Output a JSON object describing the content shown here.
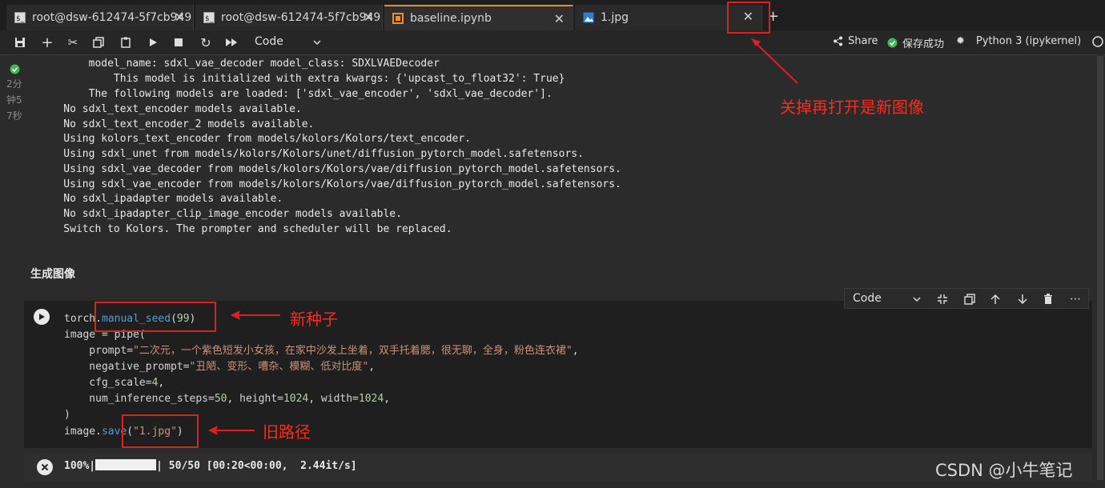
{
  "tabs": [
    {
      "label": "root@dsw-612474-5f7cb949",
      "icon": "terminal-icon"
    },
    {
      "label": "root@dsw-612474-5f7cb949",
      "icon": "terminal-icon"
    },
    {
      "label": "baseline.ipynb",
      "icon": "notebook-icon",
      "active": true
    },
    {
      "label": "1.jpg",
      "icon": "image-icon"
    }
  ],
  "toolbar": {
    "cell_type": "Code",
    "share_label": "Share",
    "saved_label": "保存成功",
    "kernel_label": "Python 3 (ipykernel)"
  },
  "output_cell": {
    "exec_time": [
      "2分",
      "钟5",
      "7秒"
    ],
    "lines": [
      "        model_name: sdxl_vae_decoder model_class: SDXLVAEDecoder",
      "            This model is initialized with extra kwargs: {'upcast_to_float32': True}",
      "        The following models are loaded: ['sdxl_vae_encoder', 'sdxl_vae_decoder'].",
      "    No sdxl_text_encoder models available.",
      "    No sdxl_text_encoder_2 models available.",
      "    Using kolors_text_encoder from models/kolors/Kolors/text_encoder.",
      "    Using sdxl_unet from models/kolors/Kolors/unet/diffusion_pytorch_model.safetensors.",
      "    Using sdxl_vae_decoder from models/kolors/Kolors/vae/diffusion_pytorch_model.safetensors.",
      "    Using sdxl_vae_encoder from models/kolors/Kolors/vae/diffusion_pytorch_model.safetensors.",
      "    No sdxl_ipadapter models available.",
      "    No sdxl_ipadapter_clip_image_encoder models available.",
      "    Switch to Kolors. The prompter and scheduler will be replaced."
    ]
  },
  "markdown_heading": "生成图像",
  "code_cell": {
    "cell_type": "Code",
    "lines": {
      "l1_a": "torch.",
      "l1_b": "manual_seed",
      "l1_c": "(",
      "l1_d": "99",
      "l1_e": ")",
      "l2": "image = pipe(",
      "l3_a": "    prompt=",
      "l3_b": "\"二次元，一个紫色短发小女孩，在家中沙发上坐着，双手托着腮，很无聊，全身，粉色连衣裙\"",
      "l3_c": ",",
      "l4_a": "    negative_prompt=",
      "l4_b": "\"丑陋、变形、嘈杂、模糊、低对比度\"",
      "l4_c": ",",
      "l5_a": "    cfg_scale=",
      "l5_b": "4",
      "l5_c": ",",
      "l6_a": "    num_inference_steps=",
      "l6_b": "50",
      "l6_c": ", height=",
      "l6_d": "1024",
      "l6_e": ", width=",
      "l6_f": "1024",
      "l6_g": ",",
      "l7": ")",
      "l8_a": "image.",
      "l8_b": "save",
      "l8_c": "(",
      "l8_d": "\"1.jpg\"",
      "l8_e": ")"
    }
  },
  "progress": {
    "prefix": "100%|",
    "suffix": "| 50/50 [00:20<00:00,  2.44it/s]",
    "fraction": 1.0
  },
  "annotations": {
    "close_note": "关掉再打开是新图像",
    "seed_note": "新种子",
    "path_note": "旧路径"
  },
  "watermark": "CSDN @小牛笔记",
  "colors": {
    "accent": "#f58b2a",
    "annotation_red": "#ff2a1a",
    "success_green": "#3fb950"
  }
}
